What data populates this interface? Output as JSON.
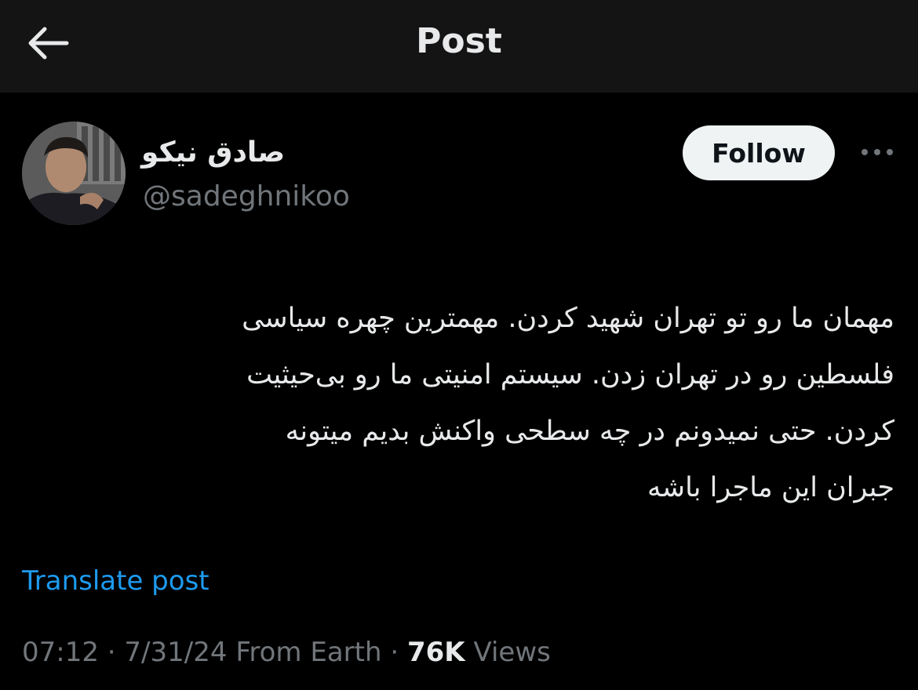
{
  "header": {
    "title": "Post",
    "back_icon": "arrow-left-icon"
  },
  "author": {
    "display_name": "صادق نیکو",
    "handle": "@sadeghnikoo",
    "follow_label": "Follow",
    "more_icon": "more-horizontal-icon"
  },
  "post": {
    "lines": [
      "مهمان ما رو تو تهران شهید کردن. مهمترین چهره سیاسی",
      "فلسطین رو در تهران زدن. سیستم امنیتی ما رو بی‌حیثیت",
      "کردن. حتی نمیدونم در چه سطحی واکنش بدیم میتونه",
      "جبران این ماجرا باشه"
    ],
    "translate_label": "Translate post"
  },
  "meta": {
    "time": "07:12",
    "separator": "·",
    "date": "7/31/24",
    "source": "From Earth",
    "views_count": "76K",
    "views_label": "Views"
  },
  "colors": {
    "background": "#000000",
    "header_bg": "#141414",
    "text": "#e7e9ea",
    "secondary": "#71767b",
    "link": "#1d9bf0",
    "follow_bg": "#eff3f4"
  }
}
